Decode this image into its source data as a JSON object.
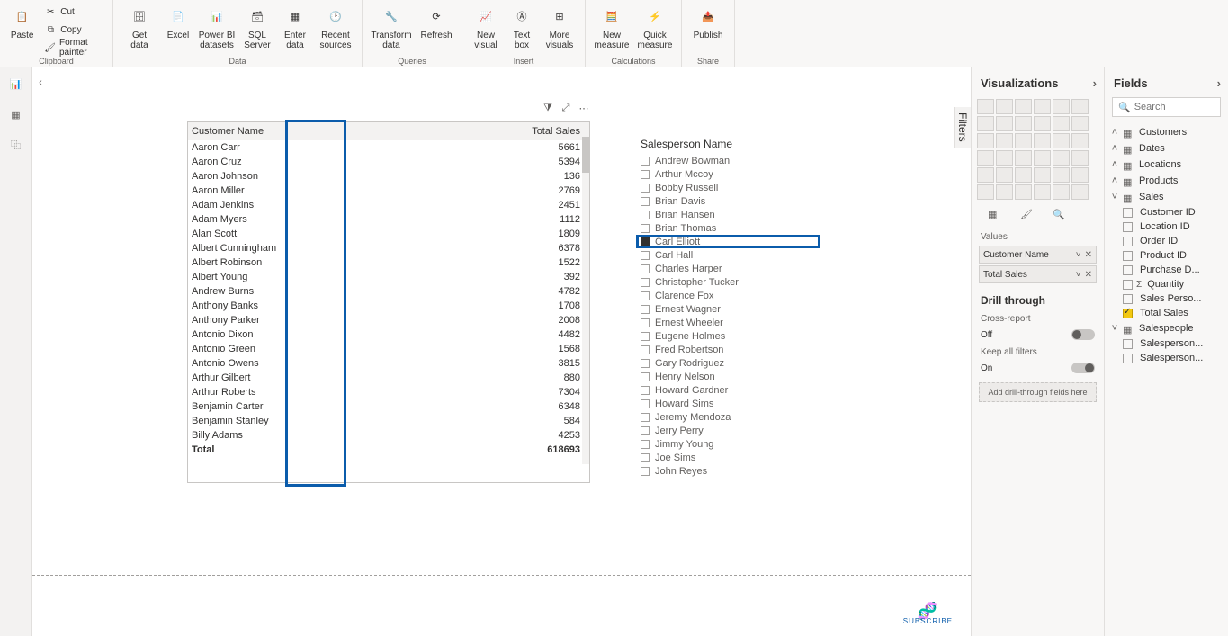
{
  "ribbon": {
    "clipboard": {
      "paste": "Paste",
      "cut": "Cut",
      "copy": "Copy",
      "format_painter": "Format painter",
      "group_label": "Clipboard"
    },
    "data": {
      "get_data": "Get\ndata",
      "excel": "Excel",
      "pbi_datasets": "Power BI\ndatasets",
      "sql_server": "SQL\nServer",
      "enter_data": "Enter\ndata",
      "recent_sources": "Recent\nsources",
      "group_label": "Data"
    },
    "queries": {
      "transform_data": "Transform\ndata",
      "refresh": "Refresh",
      "group_label": "Queries"
    },
    "insert": {
      "new_visual": "New\nvisual",
      "text_box": "Text\nbox",
      "more_visuals": "More\nvisuals",
      "group_label": "Insert"
    },
    "calculations": {
      "new_measure": "New\nmeasure",
      "quick_measure": "Quick\nmeasure",
      "group_label": "Calculations"
    },
    "share": {
      "publish": "Publish",
      "group_label": "Share"
    }
  },
  "filters_tab": "Filters",
  "table": {
    "col1": "Customer Name",
    "col2": "Total Sales",
    "rows": [
      {
        "name": "Aaron Carr",
        "value": "5661"
      },
      {
        "name": "Aaron Cruz",
        "value": "5394"
      },
      {
        "name": "Aaron Johnson",
        "value": "136"
      },
      {
        "name": "Aaron Miller",
        "value": "2769"
      },
      {
        "name": "Adam Jenkins",
        "value": "2451"
      },
      {
        "name": "Adam Myers",
        "value": "1112"
      },
      {
        "name": "Alan Scott",
        "value": "1809"
      },
      {
        "name": "Albert Cunningham",
        "value": "6378"
      },
      {
        "name": "Albert Robinson",
        "value": "1522"
      },
      {
        "name": "Albert Young",
        "value": "392"
      },
      {
        "name": "Andrew Burns",
        "value": "4782"
      },
      {
        "name": "Anthony Banks",
        "value": "1708"
      },
      {
        "name": "Anthony Parker",
        "value": "2008"
      },
      {
        "name": "Antonio Dixon",
        "value": "4482"
      },
      {
        "name": "Antonio Green",
        "value": "1568"
      },
      {
        "name": "Antonio Owens",
        "value": "3815"
      },
      {
        "name": "Arthur Gilbert",
        "value": "880"
      },
      {
        "name": "Arthur Roberts",
        "value": "7304"
      },
      {
        "name": "Benjamin Carter",
        "value": "6348"
      },
      {
        "name": "Benjamin Stanley",
        "value": "584"
      },
      {
        "name": "Billy Adams",
        "value": "4253"
      }
    ],
    "total_label": "Total",
    "total_value": "618693"
  },
  "slicer": {
    "title": "Salesperson Name",
    "items": [
      "Andrew Bowman",
      "Arthur Mccoy",
      "Bobby Russell",
      "Brian Davis",
      "Brian Hansen",
      "Brian Thomas",
      "Carl Elliott",
      "Carl Hall",
      "Charles Harper",
      "Christopher Tucker",
      "Clarence Fox",
      "Ernest Wagner",
      "Ernest Wheeler",
      "Eugene Holmes",
      "Fred Robertson",
      "Gary Rodriguez",
      "Henry Nelson",
      "Howard Gardner",
      "Howard Sims",
      "Jeremy Mendoza",
      "Jerry Perry",
      "Jimmy Young",
      "Joe Sims",
      "John Reyes"
    ],
    "selected_index": 6
  },
  "viz_pane": {
    "title": "Visualizations",
    "values_label": "Values",
    "field1": "Customer Name",
    "field2": "Total Sales",
    "drill_title": "Drill through",
    "cross_report": "Cross-report",
    "cross_off": "Off",
    "keep_filters": "Keep all filters",
    "keep_on": "On",
    "drill_placeholder": "Add drill-through fields here"
  },
  "fields_pane": {
    "title": "Fields",
    "search_placeholder": "Search",
    "tables": [
      {
        "name": "Customers",
        "expanded": false
      },
      {
        "name": "Dates",
        "expanded": false
      },
      {
        "name": "Locations",
        "expanded": false
      },
      {
        "name": "Products",
        "expanded": false
      },
      {
        "name": "Sales",
        "expanded": true,
        "children": [
          {
            "name": "Customer ID",
            "checked": false,
            "sigma": false
          },
          {
            "name": "Location ID",
            "checked": false,
            "sigma": false
          },
          {
            "name": "Order ID",
            "checked": false,
            "sigma": false
          },
          {
            "name": "Product ID",
            "checked": false,
            "sigma": false
          },
          {
            "name": "Purchase D...",
            "checked": false,
            "sigma": false
          },
          {
            "name": "Quantity",
            "checked": false,
            "sigma": true
          },
          {
            "name": "Sales Perso...",
            "checked": false,
            "sigma": false
          },
          {
            "name": "Total Sales",
            "checked": true,
            "sigma": false
          }
        ]
      },
      {
        "name": "Salespeople",
        "expanded": true,
        "children": [
          {
            "name": "Salesperson...",
            "checked": false,
            "sigma": false
          },
          {
            "name": "Salesperson...",
            "checked": false,
            "sigma": false
          }
        ]
      }
    ]
  },
  "subscribe": "SUBSCRIBE"
}
